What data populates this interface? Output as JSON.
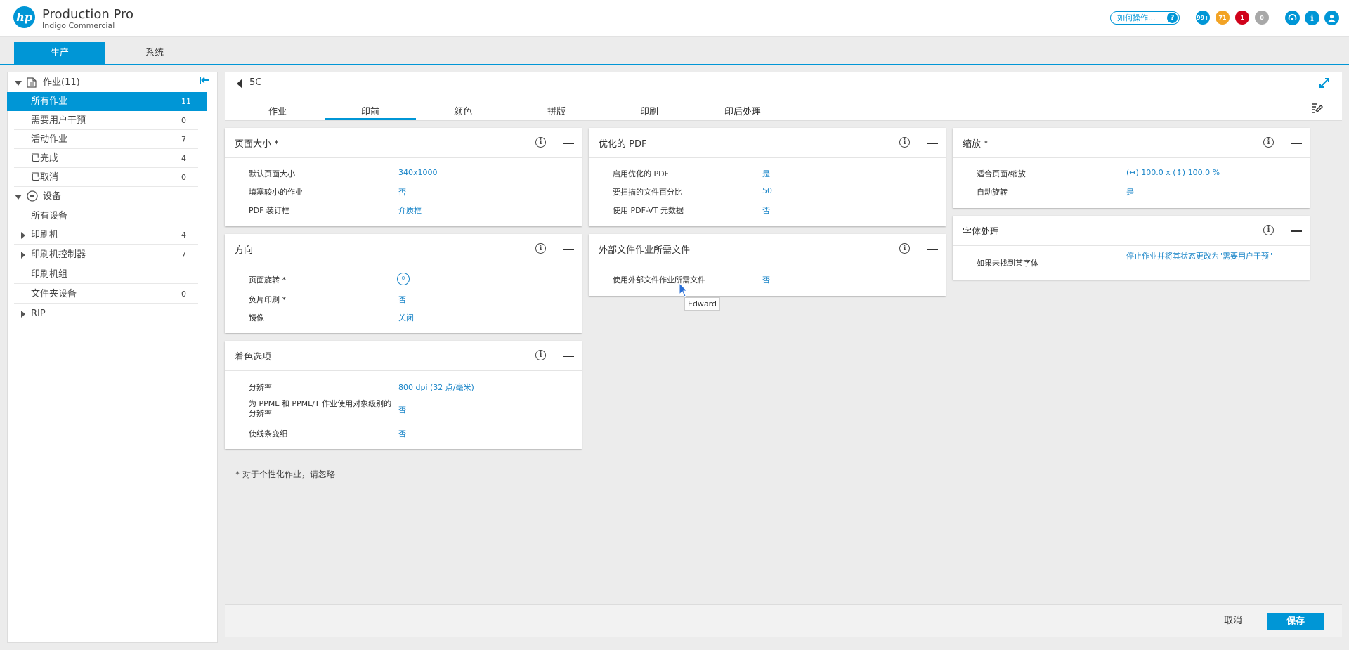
{
  "app": {
    "title": "Production Pro",
    "subtitle": "Indigo Commercial",
    "logo": "hp"
  },
  "header": {
    "howto_label": "如何操作...",
    "howto_icon": "?",
    "badges": [
      {
        "label": "99+",
        "color": "#0096d6"
      },
      {
        "label": "71",
        "color": "#f2a325"
      },
      {
        "label": "1",
        "color": "#d0021b"
      },
      {
        "label": "0",
        "color": "#a8a8a8"
      }
    ],
    "icons": [
      "settings-dial-icon",
      "info-icon",
      "user-icon"
    ]
  },
  "nav_tabs": [
    {
      "label": "生产",
      "active": true
    },
    {
      "label": "系统",
      "active": false
    }
  ],
  "sidebar": {
    "jobs_group": {
      "label": "作业(11)"
    },
    "job_items": [
      {
        "label": "所有作业",
        "count": "11",
        "selected": true
      },
      {
        "label": "需要用户干预",
        "count": "0"
      },
      {
        "label": "活动作业",
        "count": "7"
      },
      {
        "label": "已完成",
        "count": "4"
      },
      {
        "label": "已取消",
        "count": "0"
      }
    ],
    "devices_group": {
      "label": "设备"
    },
    "device_items": [
      {
        "label": "所有设备",
        "count": ""
      },
      {
        "label": "印刷机",
        "count": "4",
        "expandable": true
      },
      {
        "label": "印刷机控制器",
        "count": "7",
        "expandable": true
      },
      {
        "label": "印刷机组",
        "count": ""
      },
      {
        "label": "文件夹设备",
        "count": "0"
      },
      {
        "label": "RIP",
        "count": "",
        "expandable": true
      }
    ]
  },
  "job": {
    "name": "5C"
  },
  "content_tabs": [
    {
      "label": "作业"
    },
    {
      "label": "印前",
      "active": true
    },
    {
      "label": "颜色"
    },
    {
      "label": "拼版"
    },
    {
      "label": "印刷"
    },
    {
      "label": "印后处理"
    }
  ],
  "cards": {
    "page_size": {
      "title": "页面大小 *",
      "rows": [
        {
          "label": "默认页面大小",
          "value": "340x1000"
        },
        {
          "label": "填塞较小的作业",
          "value": "否"
        },
        {
          "label": "PDF 装订框",
          "value": "介质框"
        }
      ]
    },
    "orientation": {
      "title": "方向",
      "rows": [
        {
          "label": "页面旋转 *",
          "value": "0"
        },
        {
          "label": "负片印刷 *",
          "value": "否"
        },
        {
          "label": "镜像",
          "value": "关闭"
        }
      ]
    },
    "coloring": {
      "title": "着色选项",
      "rows": [
        {
          "label": "分辨率",
          "value": "800 dpi (32 点/毫米)"
        },
        {
          "label": "为 PPML 和 PPML/T 作业使用对象级别的分辨率",
          "value": "否"
        },
        {
          "label": "使线条变细",
          "value": "否"
        }
      ]
    },
    "optimized_pdf": {
      "title": "优化的 PDF",
      "rows": [
        {
          "label": "启用优化的 PDF",
          "value": "是"
        },
        {
          "label": "要扫描的文件百分比",
          "value": "50"
        },
        {
          "label": "使用 PDF-VT 元数据",
          "value": "否"
        }
      ]
    },
    "external_files": {
      "title": "外部文件作业所需文件",
      "rows": [
        {
          "label": "使用外部文件作业所需文件",
          "value": "否"
        }
      ]
    },
    "scaling": {
      "title": "缩放 *",
      "rows": [
        {
          "label": "适合页面/缩放",
          "value": "(↔) 100.0 x (↕) 100.0 %"
        },
        {
          "label": "自动旋转",
          "value": "是"
        }
      ]
    },
    "fonts": {
      "title": "字体处理",
      "rows": [
        {
          "label": "如果未找到某字体",
          "value": "停止作业并将其状态更改为\"需要用户干预\""
        }
      ]
    }
  },
  "footnote": "* 对于个性化作业，请忽略",
  "tooltip": "Edward",
  "buttons": {
    "cancel": "取消",
    "save": "保存"
  },
  "colors": {
    "accent": "#0096d6",
    "value_text": "#1a85c8"
  }
}
